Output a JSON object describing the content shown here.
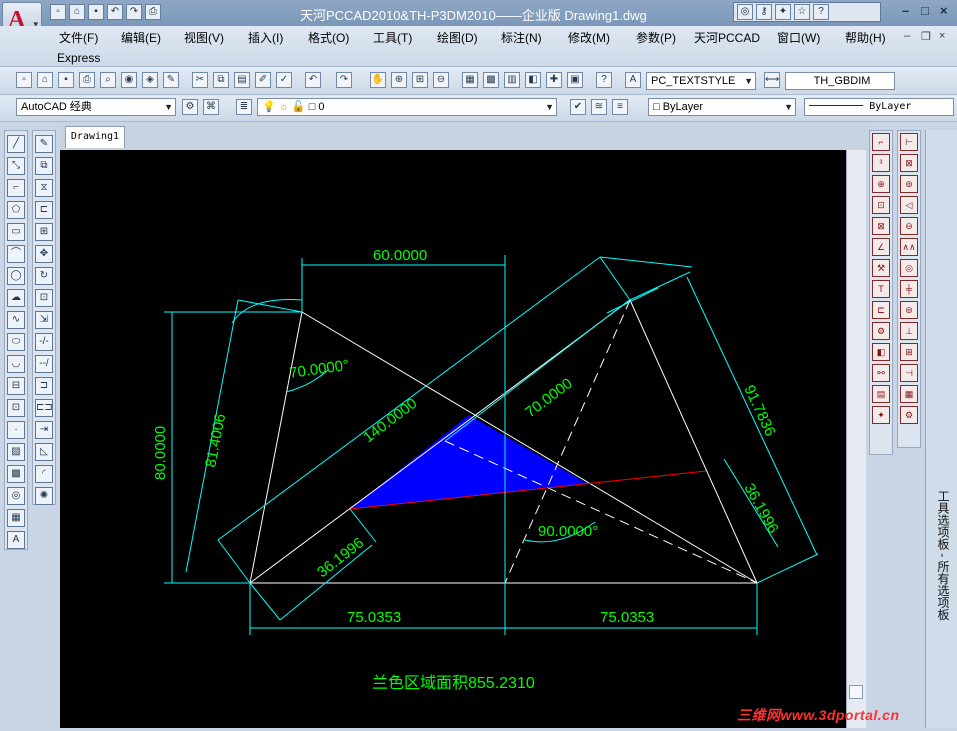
{
  "window": {
    "title": "天河PCCAD2010&TH-P3DM2010——企业版    Drawing1.dwg"
  },
  "menu": {
    "items": [
      "文件(F)",
      "编辑(E)",
      "视图(V)",
      "插入(I)",
      "格式(O)",
      "工具(T)",
      "绘图(D)",
      "标注(N)",
      "修改(M)",
      "参数(P)",
      "天河PCCAD",
      "窗口(W)",
      "帮助(H)"
    ],
    "express": "Express"
  },
  "toolbar": {
    "text_style": "PC_TEXTSTYLE",
    "dim_style": "TH_GBDIM",
    "workspace": "AutoCAD 经典",
    "layer": "0",
    "color": "ByLayer",
    "linetype": "ByLayer"
  },
  "tabs": [
    "Drawing1"
  ],
  "palette": {
    "title": "工具选项板 - 所有选项板"
  },
  "drawing": {
    "dimensions": [
      "60.0000",
      "140.0000",
      "70.0000",
      "91.7836",
      "80.0000",
      "81.4006",
      "70.0000°",
      "36.1996",
      "36.1996",
      "90.0000°",
      "75.0353",
      "75.0353"
    ],
    "area_label": "兰色区域面积855.2310"
  },
  "colors": {
    "canvas": "#000000",
    "dimension": "#00ffff",
    "dimension_text": "#00ff00",
    "geometry": "#ffffff",
    "fill": "#0000ff",
    "red_line": "#ff0000"
  },
  "watermark": "三维网www.3dportal.cn"
}
